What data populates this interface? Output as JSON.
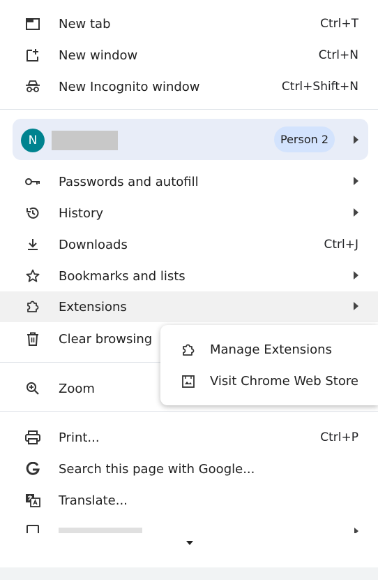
{
  "top_items": [
    {
      "label": "New tab",
      "shortcut": "Ctrl+T",
      "icon": "new-tab-icon"
    },
    {
      "label": "New window",
      "shortcut": "Ctrl+N",
      "icon": "new-window-icon"
    },
    {
      "label": "New Incognito window",
      "shortcut": "Ctrl+Shift+N",
      "icon": "incognito-icon"
    }
  ],
  "profile": {
    "avatar_letter": "N",
    "badge": "Person 2"
  },
  "mid_items": [
    {
      "label": "Passwords and autofill",
      "icon": "key-icon"
    },
    {
      "label": "History",
      "icon": "history-icon"
    },
    {
      "label": "Downloads",
      "shortcut": "Ctrl+J",
      "icon": "download-icon"
    },
    {
      "label": "Bookmarks and lists",
      "icon": "star-icon"
    },
    {
      "label": "Extensions",
      "icon": "extensions-icon"
    },
    {
      "label": "Clear browsing",
      "icon": "trash-icon"
    }
  ],
  "zoom": {
    "label": "Zoom"
  },
  "bottom_items": [
    {
      "label": "Print...",
      "shortcut": "Ctrl+P",
      "icon": "printer-icon"
    },
    {
      "label": "Search this page with Google...",
      "icon": "google-icon"
    },
    {
      "label": "Translate...",
      "icon": "translate-icon"
    }
  ],
  "extensions_submenu": [
    {
      "label": "Manage Extensions",
      "icon": "extensions-icon"
    },
    {
      "label": "Visit Chrome Web Store",
      "icon": "web-store-icon"
    }
  ],
  "colors": {
    "avatar": "#00838f",
    "profile_bg": "#e8edf8",
    "chip_bg": "#d3e3fd",
    "hover_bg": "#f1f1f1"
  }
}
